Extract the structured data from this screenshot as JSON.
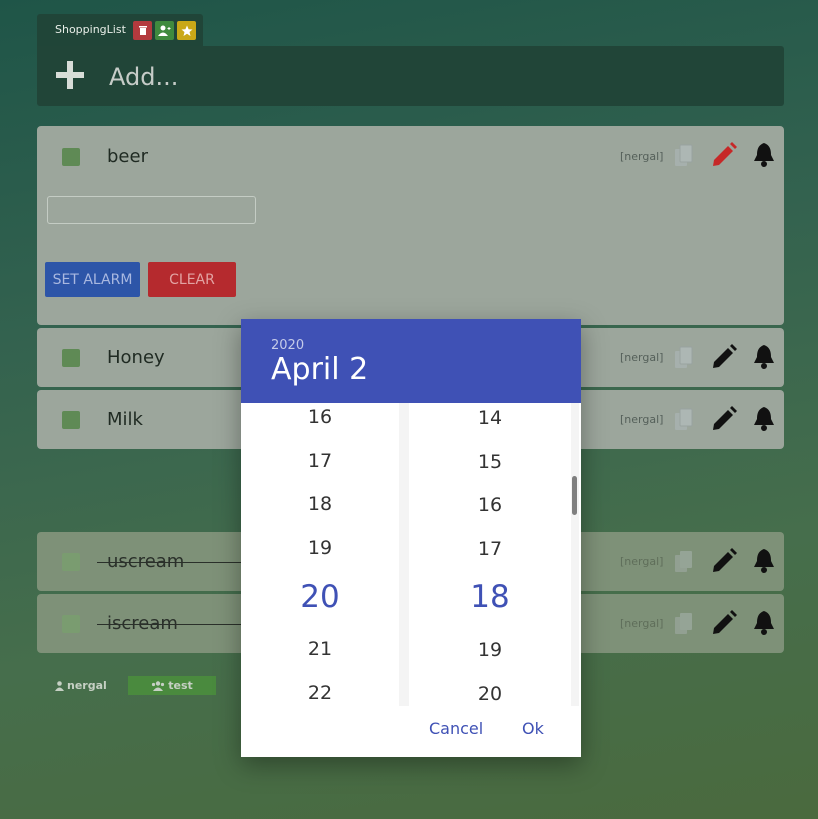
{
  "app": {
    "title": "ShoppingList"
  },
  "add": {
    "placeholder": "Add..."
  },
  "items": [
    {
      "name": "beer",
      "owner": "[nergal]"
    },
    {
      "name": "Honey",
      "owner": "[nergal]"
    },
    {
      "name": "Milk",
      "owner": "[nergal]"
    }
  ],
  "done_items": [
    {
      "name": "uscream",
      "owner": "[nergal]"
    },
    {
      "name": "iscream",
      "owner": "[nergal]"
    }
  ],
  "alarm": {
    "set_label": "SET ALARM",
    "clear_label": "CLEAR"
  },
  "users": {
    "user": "nergal",
    "group": "test"
  },
  "picker": {
    "year": "2020",
    "date": "April 2",
    "hours": [
      "16",
      "17",
      "18",
      "19",
      "20",
      "21",
      "22"
    ],
    "minutes": [
      "14",
      "15",
      "16",
      "17",
      "18",
      "19",
      "20"
    ],
    "selected_hour": "20",
    "selected_minute": "18",
    "cancel_label": "Cancel",
    "ok_label": "Ok"
  },
  "colors": {
    "accent": "#3f51b5",
    "delete": "#b52a2e",
    "edit_active": "#c62828"
  }
}
